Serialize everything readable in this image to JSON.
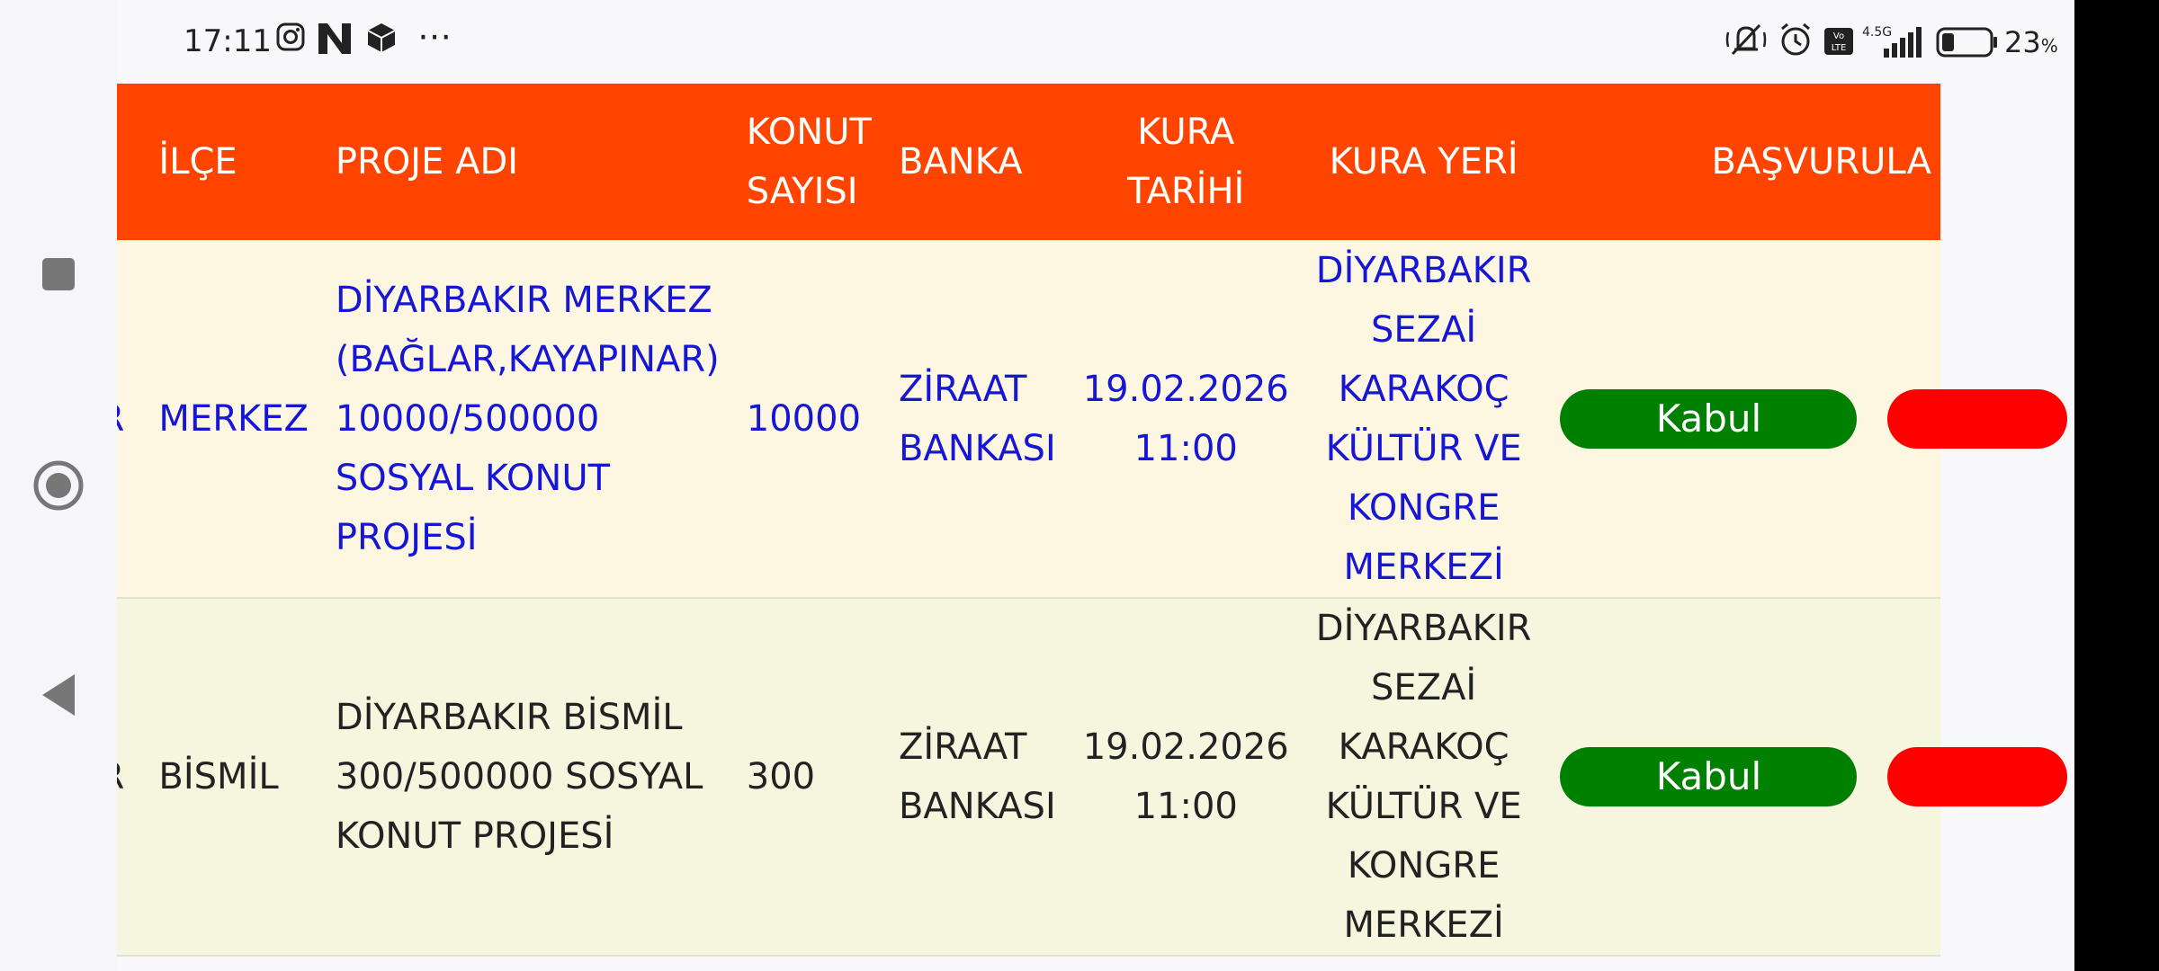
{
  "status_bar": {
    "time": "17:11",
    "network": "4.5G",
    "battery_pct": "23",
    "battery_unit": "%"
  },
  "nav_bar": {
    "icons": [
      "square-recents-icon",
      "circle-home-icon",
      "triangle-back-icon"
    ]
  },
  "table": {
    "headers": {
      "il": "",
      "ilce": "İLÇE",
      "proje": "PROJE ADI",
      "konut": "KONUT SAYISI",
      "banka": "BANKA",
      "kura_tarihi": "KURA TARİHİ",
      "kura_yeri": "KURA YERİ",
      "basvuru": "BAŞVURULA"
    },
    "rows": [
      {
        "il": "RBAKIR",
        "ilce": "MERKEZ",
        "proje": "DİYARBAKIR MERKEZ (BAĞLAR,KAYAPINAR) 10000/500000 SOSYAL KONUT PROJESİ",
        "konut": "10000",
        "banka": "ZİRAAT BANKASI",
        "kura_tarihi": "19.02.2026 11:00",
        "kura_yeri": "DİYARBAKIR SEZAİ KARAKOÇ KÜLTÜR VE KONGRE MERKEZİ",
        "accept_label": "Kabul"
      },
      {
        "il": "RBAKIR",
        "ilce": "BİSMİL",
        "proje": "DİYARBAKIR BİSMİL 300/500000 SOSYAL KONUT PROJESİ",
        "konut": "300",
        "banka": "ZİRAAT BANKASI",
        "kura_tarihi": "19.02.2026 11:00",
        "kura_yeri": "DİYARBAKIR SEZAİ KARAKOÇ KÜLTÜR VE KONGRE MERKEZİ",
        "accept_label": "Kabul"
      }
    ]
  },
  "colors": {
    "header_bg": "#ff4400",
    "row1_bg": "#fdf7e2",
    "row2_bg": "#f6f5de",
    "accept_green": "#008000",
    "reject_red": "#ff0000",
    "link_blue": "#1616d4"
  }
}
